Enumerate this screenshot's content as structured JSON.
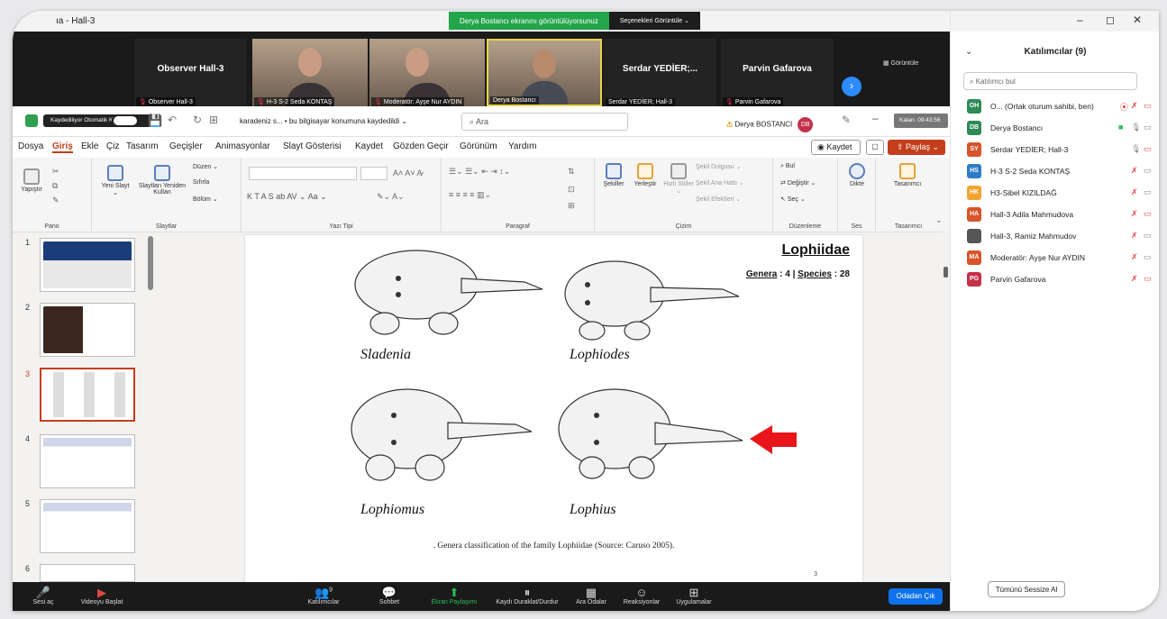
{
  "window": {
    "title": "ıa - Hall-3",
    "min": "–",
    "max": "◻",
    "close": "✕"
  },
  "share_banner": {
    "text": "Derya Bostancı ekranını görüntülüyorsunuz",
    "options": "Seçenekleri Görüntüle ⌄"
  },
  "strip": {
    "view_label": "▦ Görüntüle",
    "tiles": [
      {
        "big": "Observer Hall-3",
        "label": "Observer Hall-3",
        "muted": true
      },
      {
        "big": "",
        "label": "H-3 S-2 Seda KONTAŞ",
        "muted": true
      },
      {
        "big": "",
        "label": "Moderatör: Ayşe Nur AYDIN",
        "muted": true
      },
      {
        "big": "",
        "label": "Derya Bostancı",
        "muted": false
      },
      {
        "big": "Serdar YEDİER;...",
        "label": "Serdar YEDİER; Hall-3",
        "muted": false
      },
      {
        "big": "Parvin Gafarova",
        "label": "Parvin Gafarova",
        "muted": true
      }
    ]
  },
  "pp": {
    "recording": "Kaydediliyor",
    "autosave": "Otomatik Kaydet",
    "filename": "karadeniz s... • bu bilgisayar konumuna kaydedildi ⌄",
    "search": "Ara",
    "user": "Derya BOSTANCI",
    "user_initials": "DB",
    "timer": "Kalan: 09:43:56",
    "menu": [
      "Dosya",
      "Giriş",
      "Ekle",
      "Çiz",
      "Tasarım",
      "Geçişler",
      "Animasyonlar",
      "Slayt Gösterisi",
      "Kaydet",
      "Gözden Geçir",
      "Görünüm",
      "Yardım"
    ],
    "kaydet_btn": "◉ Kaydet",
    "comment_btn": "▢",
    "paylas_btn": "⇪ Paylaş ⌄",
    "ribbon": {
      "pano": {
        "label": "Pano",
        "yapistir": "Yapıştır"
      },
      "slaytlar": {
        "label": "Slaytlar",
        "yeni": "Yeni Slayt ⌄",
        "yeniden": "Slaytları Yeniden Kullan",
        "duzen": "Düzen ⌄",
        "sifirla": "Sıfırla",
        "bolum": "Bölüm ⌄"
      },
      "yazitipi": {
        "label": "Yazı Tipi",
        "glyphs": "K   T   A   S   ab   AV ⌄   Aa ⌄"
      },
      "paragraf": {
        "label": "Paragraf"
      },
      "cizim": {
        "label": "Çizim",
        "sekiller": "Şekiller",
        "yerlestir": "Yerleştir",
        "hizli": "Hızlı Stiller ⌄",
        "dolgu": "Şekil Dolgusu ⌄",
        "anahat": "Şekil Ana Hattı ⌄",
        "efekt": "Şekil Efektleri ⌄"
      },
      "duzenleme": {
        "label": "Düzenleme",
        "bul": "Bul",
        "degistir": "Değiştir ⌄",
        "sec": "Seç ⌄"
      },
      "ses": {
        "label": "Ses",
        "dikte": "Dikte"
      },
      "tasarimci": {
        "label": "Tasarımcı",
        "btn": "Tasarımcı"
      }
    },
    "thumbnails": [
      "1",
      "2",
      "3",
      "4",
      "5",
      "6"
    ],
    "slide": {
      "heading": "Lophiidae",
      "genera_label": "Genera",
      "genera": "4",
      "species_label": "Species",
      "species": "28",
      "fish": [
        "Sladenia",
        "Lophiodes",
        "Lophiomus",
        "Lophius"
      ],
      "caption": ". Genera classification of the family Lophiidae (Source: Caruso 2005).",
      "page": "3"
    }
  },
  "zoom": {
    "items": [
      {
        "label": "Sesi aç",
        "icon": "🎤"
      },
      {
        "label": "Videoyu Başlat",
        "icon": "▶"
      },
      {
        "label": "Katılımcılar",
        "icon": "👥",
        "badge": "9"
      },
      {
        "label": "Sohbet",
        "icon": "💬"
      },
      {
        "label": "Ekran Paylaşımı",
        "icon": "⬆"
      },
      {
        "label": "Kaydı Duraklat/Durdur",
        "icon": "⏸"
      },
      {
        "label": "Ara Odalar",
        "icon": "▦"
      },
      {
        "label": "Reaksiyonlar",
        "icon": "☺"
      },
      {
        "label": "Uygulamalar",
        "icon": "⊞"
      }
    ],
    "leave": "Odadan Çık"
  },
  "participants": {
    "title": "Katılımcılar (9)",
    "search": "Katılımcı bul",
    "list": [
      {
        "initials": "OH",
        "name": "O... (Ortak oturum sahibi, ben)",
        "color": "#2e8b57"
      },
      {
        "initials": "DB",
        "name": "Derya Bostancı",
        "color": "#2e8b57"
      },
      {
        "initials": "SY",
        "name": "Serdar YEDİER; Hall-3",
        "color": "#d9542b"
      },
      {
        "initials": "HS",
        "name": "H-3 S-2 Seda KONTAŞ",
        "color": "#2c7cc6"
      },
      {
        "initials": "HK",
        "name": "H3-Sibel KIZILDAĞ",
        "color": "#f0a430"
      },
      {
        "initials": "HA",
        "name": "Hall-3 Adila Mahmudova",
        "color": "#d9542b"
      },
      {
        "initials": "",
        "name": "Hall-3, Ramiz Mahmudov",
        "color": "#555555"
      },
      {
        "initials": "MA",
        "name": "Moderatör: Ayşe Nur AYDIN",
        "color": "#d9542b"
      },
      {
        "initials": "PG",
        "name": "Parvin Gafarova",
        "color": "#c4314b"
      }
    ],
    "mute_all": "Tümünü Sessize Al"
  }
}
